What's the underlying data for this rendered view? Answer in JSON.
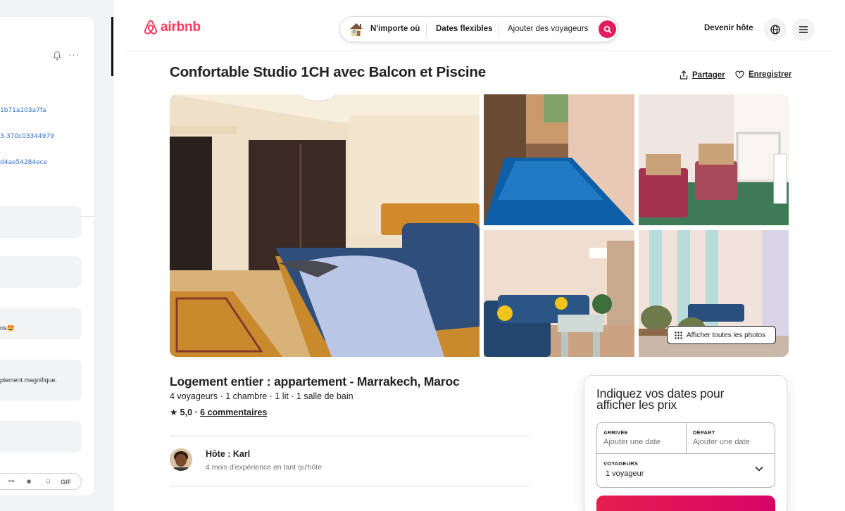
{
  "left_panel": {
    "ids": [
      "1b71a103a7fa",
      "3-370c03344979",
      "d4ae54284ece"
    ],
    "messages": [
      "ns🤩",
      "plement magnifique."
    ],
    "composer_gif": "GIF"
  },
  "header": {
    "logo_text": "airbnb",
    "search": {
      "where": "N'importe où",
      "when": "Dates flexibles",
      "who": "Ajouter des voyageurs"
    },
    "become_host": "Devenir hôte"
  },
  "listing": {
    "title": "Confortable Studio 1CH avec Balcon et Piscine",
    "share": "Partager",
    "save": "Enregistrer",
    "show_all_photos": "Afficher toutes les photos",
    "type": "Logement entier : appartement - Marrakech, Maroc",
    "meta": "4 voyageurs · 1 chambre · 1 lit · 1 salle de bain",
    "rating": "★ 5,0 · ",
    "reviews": "6 commentaires",
    "host_name": "Hôte : Karl",
    "host_experience": "4 mois d'expérience en tant qu'hôte"
  },
  "booking": {
    "title": "Indiquez vos dates pour afficher les prix",
    "checkin_label": "ARRIVÉE",
    "checkin_value": "Ajouter une date",
    "checkout_label": "DÉPART",
    "checkout_value": "Ajouter une date",
    "guests_label": "VOYAGEURS",
    "guests_value": "1 voyageur"
  },
  "colors": {
    "brand": "#ff385c",
    "search_button": "#e31c5f",
    "link_blue": "#2f6fd6"
  }
}
